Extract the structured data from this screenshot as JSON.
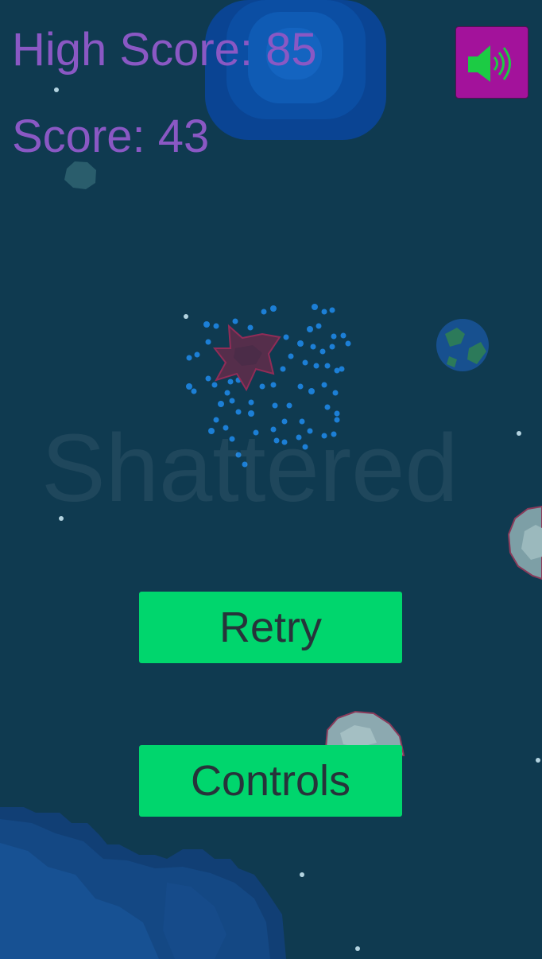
{
  "hud": {
    "high_score_label": "High Score: 85",
    "score_label": "Score: 43"
  },
  "game": {
    "title": "Shattered"
  },
  "menu": {
    "retry_label": "Retry",
    "controls_label": "Controls"
  },
  "sound": {
    "state": "on",
    "icon": "speaker-on-icon"
  },
  "colors": {
    "background": "#0f3a50",
    "hud_text": "#8a58c4",
    "button": "#00d66d",
    "button_text": "#27333a",
    "sound_button": "#a3129b",
    "sound_icon": "#1ccb44"
  }
}
